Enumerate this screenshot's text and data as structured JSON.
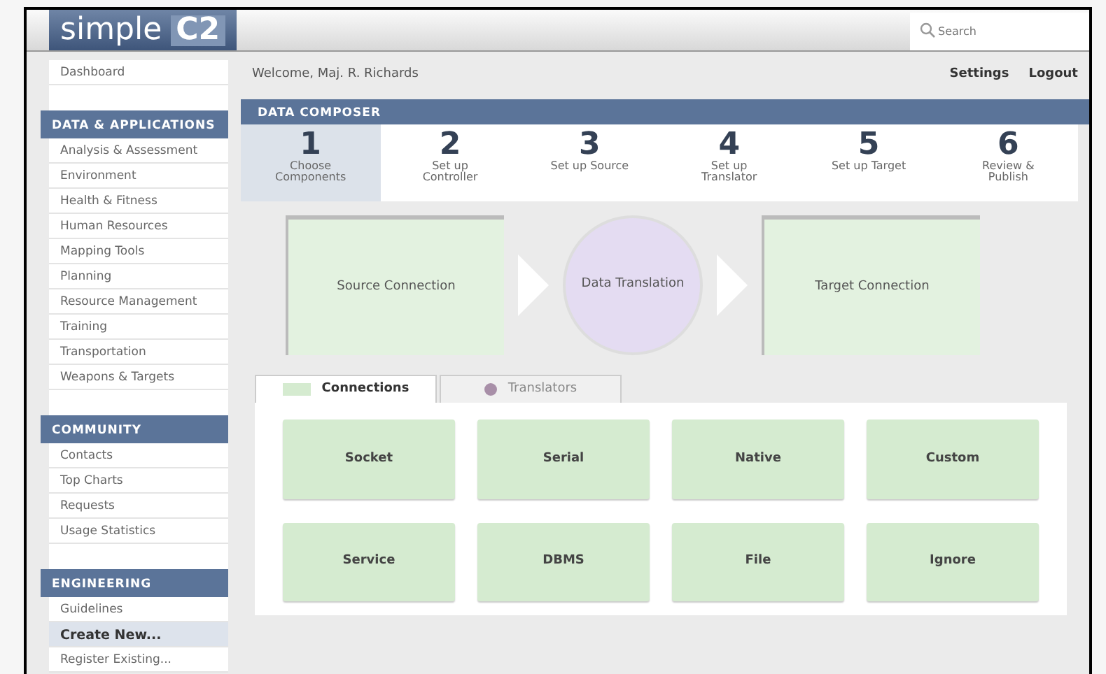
{
  "header": {
    "logo": {
      "part1": "simple",
      "part2": "C2"
    },
    "search": {
      "placeholder": "Search"
    }
  },
  "sidebar": {
    "top_item": {
      "label": "Dashboard"
    },
    "sections": [
      {
        "title": "DATA & APPLICATIONS",
        "items": [
          {
            "label": "Analysis & Assessment",
            "selected": false
          },
          {
            "label": "Environment",
            "selected": false
          },
          {
            "label": "Health & Fitness",
            "selected": false
          },
          {
            "label": "Human Resources",
            "selected": false
          },
          {
            "label": "Mapping Tools",
            "selected": false
          },
          {
            "label": "Planning",
            "selected": false
          },
          {
            "label": "Resource Management",
            "selected": false
          },
          {
            "label": "Training",
            "selected": false
          },
          {
            "label": "Transportation",
            "selected": false
          },
          {
            "label": "Weapons & Targets",
            "selected": false
          }
        ]
      },
      {
        "title": "COMMUNITY",
        "items": [
          {
            "label": "Contacts",
            "selected": false
          },
          {
            "label": "Top Charts",
            "selected": false
          },
          {
            "label": "Requests",
            "selected": false
          },
          {
            "label": "Usage Statistics",
            "selected": false
          }
        ]
      },
      {
        "title": "ENGINEERING",
        "items": [
          {
            "label": "Guidelines",
            "selected": false
          },
          {
            "label": "Create New...",
            "selected": true
          },
          {
            "label": "Register Existing...",
            "selected": false
          }
        ]
      }
    ]
  },
  "topbar": {
    "welcome": "Welcome, Maj. R. Richards",
    "links": [
      "Settings",
      "Logout"
    ]
  },
  "composer": {
    "title": "DATA COMPOSER",
    "steps": [
      {
        "number": "1",
        "label": "Choose Components",
        "selected": true
      },
      {
        "number": "2",
        "label": "Set up Controller",
        "selected": false
      },
      {
        "number": "3",
        "label": "Set up Source",
        "selected": false
      },
      {
        "number": "4",
        "label": "Set up Translator",
        "selected": false
      },
      {
        "number": "5",
        "label": "Set up Target",
        "selected": false
      },
      {
        "number": "6",
        "label": "Review & Publish",
        "selected": false
      }
    ],
    "flow": [
      {
        "kind": "box",
        "label": "Source Connection",
        "color": "#e3f2e0"
      },
      {
        "kind": "circle",
        "label": "Data Translation",
        "color": "#e4dcf2"
      },
      {
        "kind": "box",
        "label": "Target Connection",
        "color": "#e3f2e0"
      }
    ],
    "tabs": [
      {
        "label": "Connections",
        "selected": true,
        "color": "#d5ebd0"
      },
      {
        "label": "Translators",
        "selected": false,
        "color": "#a88fa8"
      }
    ],
    "tiles": [
      "Socket",
      "Serial",
      "Native",
      "Custom",
      "Service",
      "DBMS",
      "File",
      "Ignore"
    ]
  }
}
